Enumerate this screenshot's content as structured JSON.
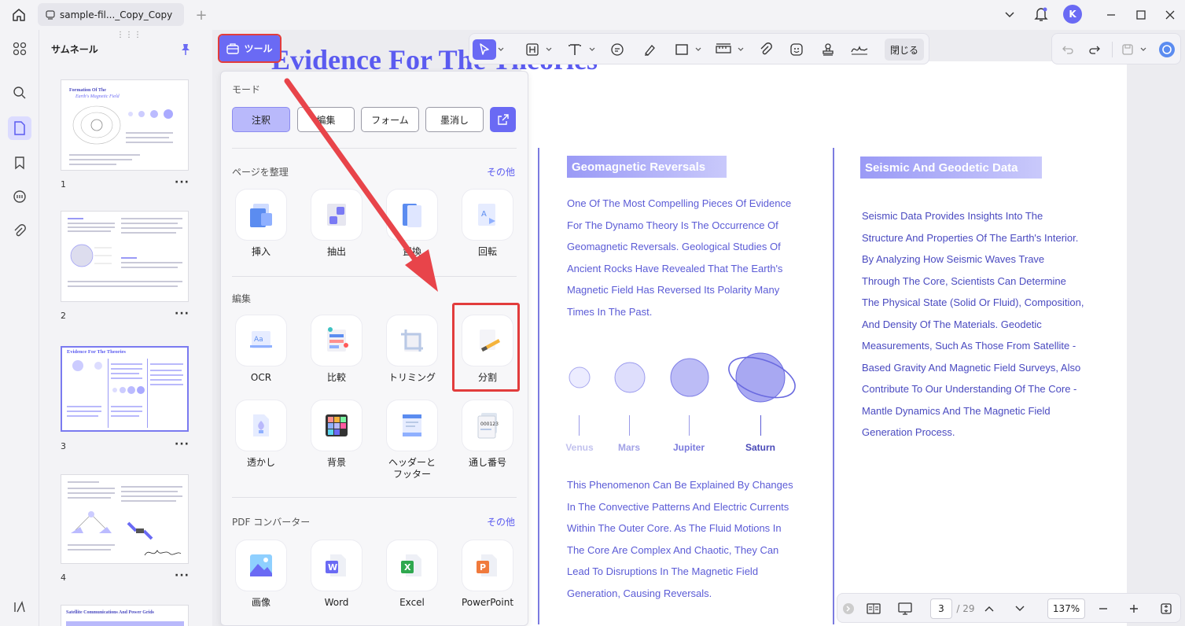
{
  "titlebar": {
    "tab_title": "sample-fil..._Copy_Copy",
    "avatar_letter": "K"
  },
  "sidebar": {
    "panel_title": "サムネール",
    "pages": [
      "1",
      "2",
      "3",
      "4"
    ],
    "more_glyph": "···",
    "thumb1_title_line1": "Formation Of The",
    "thumb1_title_line2": "Earth's Magnetic Field",
    "thumb3_title": "Evidence For The Theories",
    "thumb5_title": "Satellite Communications And Power Grids"
  },
  "annotation_toolbar": {
    "close_label": "閉じる"
  },
  "tools_button": {
    "label": "ツール"
  },
  "tools_panel": {
    "mode_label": "モード",
    "modes": [
      "注釈",
      "編集",
      "フォーム",
      "墨消し"
    ],
    "organize_label": "ページを整理",
    "organize_more": "その他",
    "organize_tools": [
      "挿入",
      "抽出",
      "置換",
      "回転"
    ],
    "edit_label": "編集",
    "edit_tools": [
      "OCR",
      "比較",
      "トリミング",
      "分割",
      "透かし",
      "背景",
      "ヘッダーと\nフッター",
      "通し番号"
    ],
    "converter_label": "PDF コンバーター",
    "converter_more": "その他",
    "converter_tools": [
      "画像",
      "Word",
      "Excel",
      "PowerPoint"
    ]
  },
  "document": {
    "title": "Evidence For The Theories",
    "left_heading": "Geomagnetic Reversals",
    "left_para1": [
      "One Of The Most Compelling Pieces Of Evidence",
      "For The Dynamo Theory Is The Occurrence Of",
      "Geomagnetic Reversals. Geological Studies Of",
      "Ancient Rocks Have Revealed That The Earth's",
      "Magnetic Field Has Reversed Its Polarity Many",
      "Times In The Past."
    ],
    "planets": [
      "Venus",
      "Mars",
      "Jupiter",
      "Saturn"
    ],
    "left_para2": [
      "This Phenomenon Can Be Explained By Changes",
      "In The Convective Patterns And Electric Currents",
      "Within The Outer Core. As The Fluid Motions In",
      "The Core Are Complex And Chaotic, They Can",
      "Lead To Disruptions In The Magnetic Field",
      "Generation, Causing Reversals."
    ],
    "right_heading": "Seismic And Geodetic Data",
    "right_para": [
      "Seismic Data Provides Insights Into The",
      "Structure And Properties Of The Earth's Interior.",
      "By Analyzing How Seismic Waves Trave",
      "Through The Core, Scientists Can Determine",
      "The Physical State (Solid Or Fluid), Composition,",
      "And Density Of The Materials. Geodetic",
      "Measurements, Such As Those From Satellite -",
      "Based Gravity And Magnetic Field Surveys, Also",
      "Contribute To Our Understanding Of The Core -",
      "Mantle Dynamics And The Magnetic Field",
      "Generation Process."
    ]
  },
  "bottom_bar": {
    "current_page": "3",
    "total_pages": "/ 29",
    "zoom": "137%"
  },
  "colors": {
    "accent": "#6a6af4",
    "highlight_red": "#e23c3c",
    "doc_text": "#5b5bd6"
  }
}
